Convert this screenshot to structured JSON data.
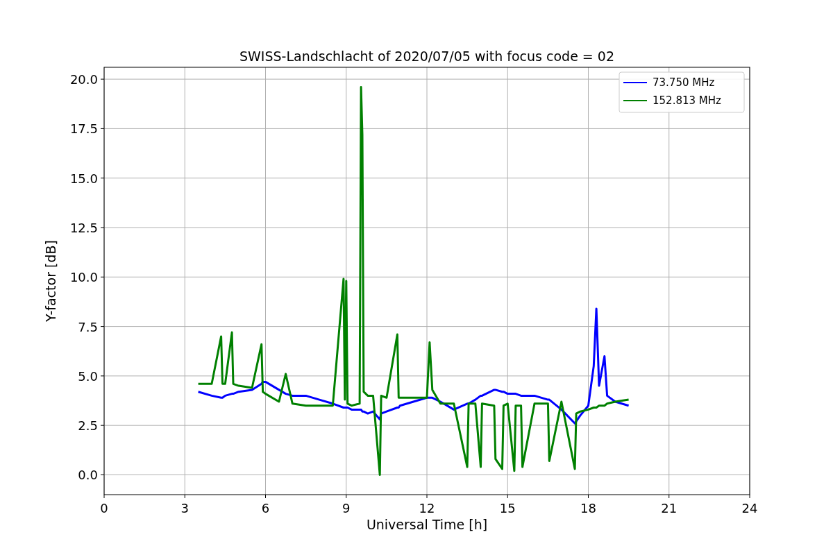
{
  "chart_data": {
    "type": "line",
    "title": "SWISS-Landschlacht of 2020/07/05 with focus code = 02",
    "xlabel": "Universal Time [h]",
    "ylabel": "Y-factor [dB]",
    "x": [
      3.5,
      4,
      4.35,
      4.4,
      4.5,
      4.75,
      4.8,
      5,
      5.5,
      5.85,
      5.9,
      6,
      6.5,
      6.75,
      7,
      7.5,
      8,
      8.5,
      8.9,
      8.95,
      9,
      9.05,
      9.2,
      9.5,
      9.55,
      9.6,
      9.65,
      9.8,
      10,
      10.25,
      10.3,
      10.5,
      10.9,
      10.95,
      11,
      11.5,
      12,
      12.1,
      12.2,
      12.5,
      13,
      13.5,
      13.55,
      13.8,
      14,
      14.05,
      14.5,
      14.55,
      14.8,
      14.85,
      15,
      15.25,
      15.3,
      15.5,
      15.55,
      16,
      16.5,
      16.55,
      17,
      17.5,
      17.55,
      17.7,
      18,
      18.2,
      18.3,
      18.4,
      18.6,
      18.7,
      19,
      19.5
    ],
    "series": [
      {
        "name": "73.750 MHz",
        "color": "#0000ff",
        "values": [
          4.2,
          4.0,
          3.9,
          3.9,
          4.0,
          4.1,
          4.1,
          4.2,
          4.3,
          4.6,
          4.7,
          4.7,
          4.3,
          4.1,
          4.0,
          4.0,
          3.8,
          3.6,
          3.4,
          3.4,
          3.4,
          3.4,
          3.3,
          3.3,
          3.3,
          3.2,
          3.2,
          3.1,
          3.2,
          2.8,
          3.1,
          3.2,
          3.4,
          3.4,
          3.5,
          3.7,
          3.9,
          3.9,
          3.9,
          3.7,
          3.3,
          3.6,
          3.6,
          3.8,
          4.0,
          4.0,
          4.3,
          4.3,
          4.2,
          4.2,
          4.1,
          4.1,
          4.1,
          4.0,
          4.0,
          4.0,
          3.8,
          3.8,
          3.3,
          2.6,
          2.7,
          3.0,
          3.5,
          5.5,
          8.4,
          4.5,
          6.0,
          4.0,
          3.7,
          3.5
        ]
      },
      {
        "name": "152.813 MHz",
        "color": "#008000",
        "values": [
          4.6,
          4.6,
          7.0,
          4.6,
          4.6,
          7.2,
          4.6,
          4.5,
          4.4,
          6.6,
          4.2,
          4.1,
          3.7,
          5.1,
          3.6,
          3.5,
          3.5,
          3.5,
          9.9,
          3.8,
          9.8,
          3.6,
          3.5,
          3.6,
          19.6,
          17.2,
          4.2,
          4.0,
          4.0,
          0.0,
          4.0,
          3.9,
          7.1,
          3.9,
          3.9,
          3.9,
          3.9,
          6.7,
          4.3,
          3.6,
          3.6,
          0.4,
          3.6,
          3.6,
          0.4,
          3.6,
          3.5,
          0.8,
          0.3,
          3.5,
          3.6,
          0.2,
          3.5,
          3.5,
          0.4,
          3.6,
          3.6,
          0.7,
          3.7,
          0.3,
          3.1,
          3.2,
          3.3,
          3.4,
          3.4,
          3.5,
          3.5,
          3.6,
          3.7,
          3.8
        ]
      }
    ],
    "grid": true,
    "legend": true,
    "xlim": [
      0,
      24
    ],
    "ylim": [
      -1,
      20.6
    ],
    "xticks": [
      0,
      3,
      6,
      9,
      12,
      15,
      18,
      21,
      24
    ],
    "yticks": [
      {
        "value": 0,
        "label": "0.0"
      },
      {
        "value": 2.5,
        "label": "2.5"
      },
      {
        "value": 5,
        "label": "5.0"
      },
      {
        "value": 7.5,
        "label": "7.5"
      },
      {
        "value": 10,
        "label": "10.0"
      },
      {
        "value": 12.5,
        "label": "12.5"
      },
      {
        "value": 15,
        "label": "15.0"
      },
      {
        "value": 17.5,
        "label": "17.5"
      },
      {
        "value": 20,
        "label": "20.0"
      }
    ]
  }
}
